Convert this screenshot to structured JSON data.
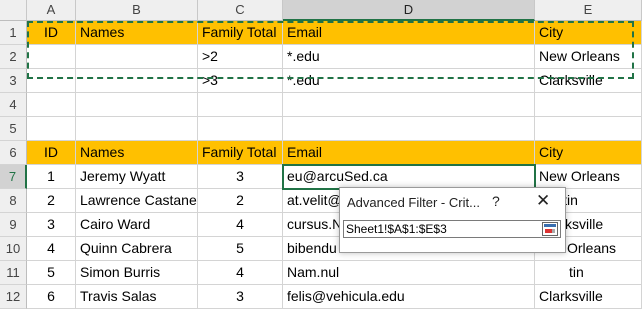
{
  "columns": [
    "A",
    "B",
    "C",
    "D",
    "E"
  ],
  "selected_column": "D",
  "criteria": {
    "header": [
      "ID",
      "Names",
      "Family Total",
      "Email",
      "City"
    ],
    "rows": [
      [
        "",
        "",
        ">2",
        "*.edu",
        "New Orleans"
      ],
      [
        "",
        "",
        ">3",
        "*.edu",
        "Clarksville"
      ]
    ]
  },
  "row_numbers": [
    "1",
    "2",
    "3",
    "4",
    "5",
    "6",
    "7",
    "8",
    "9",
    "10",
    "11",
    "12"
  ],
  "active_row": "7",
  "table": {
    "header": [
      "ID",
      "Names",
      "Family Total",
      "Email",
      "City"
    ],
    "rows": [
      [
        "1",
        "Jeremy Wyatt",
        "3",
        "eu@arcuSed.ca",
        "New Orleans"
      ],
      [
        "2",
        "Lawrence Castaneda",
        "2",
        "at.velit@porttitor.net",
        "Austin"
      ],
      [
        "3",
        "Cairo Ward",
        "4",
        "cursus.N",
        "ksville"
      ],
      [
        "4",
        "Quinn Cabrera",
        "5",
        "bibendu",
        "Orleans"
      ],
      [
        "5",
        "Simon Burris",
        "4",
        "Nam.nul",
        "tin"
      ],
      [
        "6",
        "Travis Salas",
        "3",
        "felis@vehicula.edu",
        "Clarksville"
      ]
    ]
  },
  "dialog": {
    "title": "Advanced Filter - Crit...",
    "help": "?",
    "close": "✕",
    "range_value": "Sheet1!$A$1:$E$3"
  }
}
